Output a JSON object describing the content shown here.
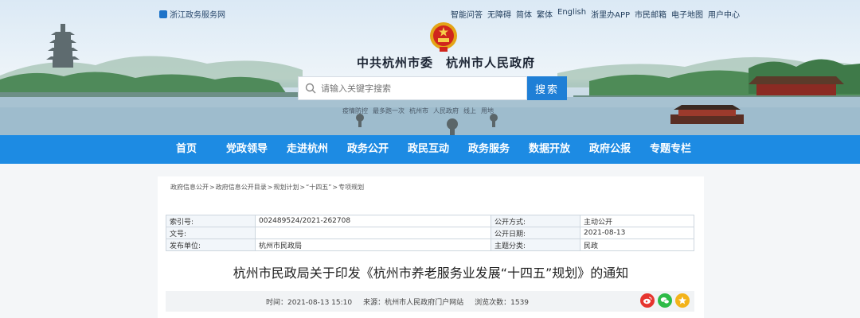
{
  "top_bar": {
    "site_name": "浙江政务服务网",
    "links": [
      "智能问答",
      "无障碍",
      "简体",
      "繁体",
      "English",
      "浙里办APP",
      "市民邮箱",
      "电子地图",
      "用户中心"
    ]
  },
  "header": {
    "title": "中共杭州市委　杭州市人民政府"
  },
  "search": {
    "placeholder": "请输入关键字搜索",
    "button_label": "搜索",
    "hot_words": [
      "疫情防控",
      "最多跑一次",
      "杭州市",
      "人民政府",
      "线上",
      "用地"
    ]
  },
  "nav": {
    "items": [
      "首页",
      "党政领导",
      "走进杭州",
      "政务公开",
      "政民互动",
      "政务服务",
      "数据开放",
      "政府公报",
      "专题专栏"
    ]
  },
  "breadcrumb": [
    "政府信息公开",
    "政府信息公开目录",
    "规划计划",
    "“十四五”",
    "专项规划"
  ],
  "meta_table": {
    "rows": [
      {
        "l1": "索引号:",
        "v1": "002489524/2021-262708",
        "l2": "公开方式:",
        "v2": "主动公开"
      },
      {
        "l1": "文号:",
        "v1": "",
        "l2": "公开日期:",
        "v2": "2021-08-13"
      },
      {
        "l1": "发布单位:",
        "v1": "杭州市民政局",
        "l2": "主题分类:",
        "v2": "民政"
      }
    ]
  },
  "document": {
    "title": "杭州市民政局关于印发《杭州市养老服务业发展“十四五”规划》的通知",
    "time": "时间：2021-08-13 15:10",
    "source": "来源：杭州市人民政府门户网站",
    "views": "浏览次数：1539"
  },
  "colors": {
    "nav_bg": "#1d8be3",
    "search_button": "#1f7fd6",
    "weibo": "#e6352f",
    "wechat": "#2dbb47",
    "favorite": "#f3b31a"
  },
  "icons": [
    "search-icon",
    "weibo-icon",
    "wechat-icon",
    "star-icon",
    "national-emblem-icon"
  ]
}
